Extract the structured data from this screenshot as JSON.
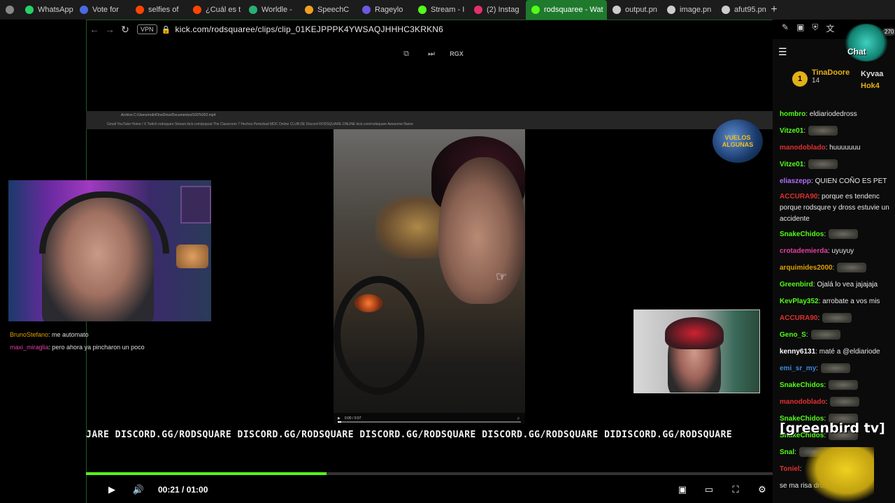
{
  "tabs": [
    {
      "label": "",
      "icon": "tab-list-icon",
      "color": "#888888"
    },
    {
      "label": "WhatsApp",
      "icon": "whatsapp-icon",
      "color": "#25d366"
    },
    {
      "label": "Vote for",
      "icon": "vote-icon",
      "color": "#4a6ae0"
    },
    {
      "label": "selfies of",
      "icon": "reddit-icon",
      "color": "#ff4500"
    },
    {
      "label": "¿Cuál es t",
      "icon": "reddit-icon",
      "color": "#ff4500"
    },
    {
      "label": "Worldle -",
      "icon": "globe-icon",
      "color": "#2ab070"
    },
    {
      "label": "SpeechC",
      "icon": "speech-icon",
      "color": "#f0a020"
    },
    {
      "label": "Rageylo",
      "icon": "rageylo-icon",
      "color": "#6a5ae0"
    },
    {
      "label": "Stream - I",
      "icon": "kick-icon",
      "color": "#53fc18"
    },
    {
      "label": "(2) Instag",
      "icon": "instagram-icon",
      "color": "#e1306c"
    },
    {
      "label": "rodsquaree - Wat",
      "icon": "kick-icon",
      "color": "#53fc18",
      "active": true
    },
    {
      "label": "output.pn",
      "icon": "file-icon",
      "color": "#cccccc"
    },
    {
      "label": "image.pn",
      "icon": "file-icon",
      "color": "#cccccc"
    },
    {
      "label": "afut95.pn",
      "icon": "file-icon",
      "color": "#cccccc"
    }
  ],
  "address": {
    "vpn": "VPN",
    "url": "kick.com/rodsquaree/clips/clip_01KEJPPPK4YWSAQJHHHC3KRKN6"
  },
  "player": {
    "top_label": "RGX",
    "time": "00:21 / 01:00",
    "progress": 0.35,
    "ticker": "JARE DISCORD.GG/RODSQUARE DISCORD.GG/RODSQUARE DISCORD.GG/RODSQUARE DISCORD.GG/RODSQUARE DIDISCORD.GG/RODSQUARE",
    "inner_video_time": "0:00 / 0:07",
    "globe_text": "VUELOS ALGUNAS"
  },
  "minichat": [
    {
      "user": "BrunoStefano",
      "text": ": me automato",
      "color": "#e0a000"
    },
    {
      "user": "maxi_miraglia",
      "text": ": pero ahora ya pincharon un poco",
      "color": "#e040a0"
    }
  ],
  "chat": {
    "pinned_rank": "1",
    "pinned_user": "TinaDoore",
    "pinned_count": "14",
    "side_users": [
      "Kyvaa",
      "Hok4"
    ],
    "avatar_count": "270",
    "avatar_text": "Chat",
    "overlay": "[greenbird tv]",
    "messages": [
      {
        "user": "hombro",
        "text": ": eldiariodedross",
        "color": "#53fc18"
      },
      {
        "user": "Vitze01",
        "text": ":",
        "color": "#53fc18",
        "emote": true
      },
      {
        "user": "manodoblado",
        "text": ": huuuuuuu",
        "color": "#e03030"
      },
      {
        "user": "Vitze01",
        "text": ":",
        "color": "#53fc18",
        "emote": true
      },
      {
        "user": "eliaszepp",
        "text": ": QUIEN COÑO ES PET",
        "color": "#b070ff"
      },
      {
        "user": "ACCURA90",
        "text": ": porque es tendenc porque rodsqure y dross estuvie un accidente",
        "color": "#e03030",
        "wrap": true
      },
      {
        "user": "SnakeChidos",
        "text": ":",
        "color": "#53fc18",
        "emote": true
      },
      {
        "user": "crotademierda",
        "text": ": uyuyuy",
        "color": "#e040a0"
      },
      {
        "user": "arquimides2000",
        "text": ":",
        "color": "#e0a000",
        "emote": true
      },
      {
        "user": "Greenbird",
        "text": ": Ojalá lo vea jajajaja",
        "color": "#53fc18"
      },
      {
        "user": "KevPlay352",
        "text": ": arrobate a vos mis",
        "color": "#53fc18"
      },
      {
        "user": "ACCURA90",
        "text": ":",
        "color": "#e03030",
        "emote": true
      },
      {
        "user": "Geno_S",
        "text": ":",
        "color": "#53fc18",
        "emote": true
      },
      {
        "user": "kenny6131",
        "text": ": maté a @eldiariode",
        "color": "#ffffff"
      },
      {
        "user": "emi_sr_my",
        "text": ":",
        "color": "#3a8ae0",
        "emote": true
      },
      {
        "user": "SnakeChidos",
        "text": ":",
        "color": "#53fc18",
        "emote": true
      },
      {
        "user": "manodoblado",
        "text": ":",
        "color": "#e03030",
        "emote": true
      },
      {
        "user": "SnakeChidos",
        "text": ":",
        "color": "#53fc18",
        "emote": true
      },
      {
        "user": "SnakeChidos",
        "text": ":",
        "color": "#53fc18",
        "emote": true
      },
      {
        "user": "Snal",
        "text": ":",
        "color": "#53fc18",
        "emote": true
      },
      {
        "user": "Toniel",
        "text": ":",
        "color": "#e03030"
      },
      {
        "user": "",
        "text": "se ma risa dros",
        "color": "#ffffff"
      }
    ]
  }
}
